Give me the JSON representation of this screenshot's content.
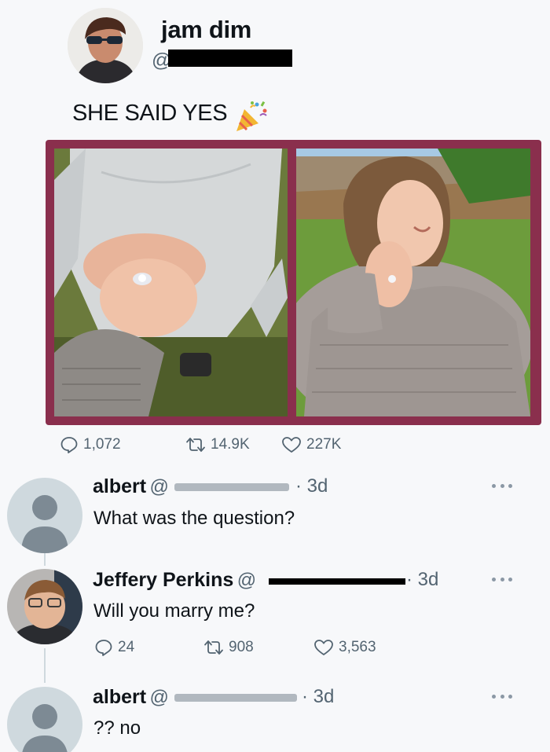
{
  "tweet": {
    "author_name": "jam dim",
    "handle_prefix": "@",
    "text": "SHE SAID YES",
    "emoji_icon": "party-popper-icon",
    "stats": {
      "replies": "1,072",
      "retweets": "14.9K",
      "likes": "227K"
    }
  },
  "replies": [
    {
      "name": "albert",
      "handle_prefix": "@",
      "time": "· 3d",
      "text": "What was the question?"
    },
    {
      "name": "Jeffery Perkins",
      "handle_prefix": "@",
      "time": "· 3d",
      "text": "Will you marry me?",
      "stats": {
        "replies": "24",
        "retweets": "908",
        "likes": "3,563"
      }
    },
    {
      "name": "albert",
      "handle_prefix": "@",
      "time": "· 3d",
      "text": "?? no"
    }
  ],
  "colors": {
    "frame": "#8a2f4d",
    "muted": "#536471",
    "background": "#f7f8fa"
  }
}
